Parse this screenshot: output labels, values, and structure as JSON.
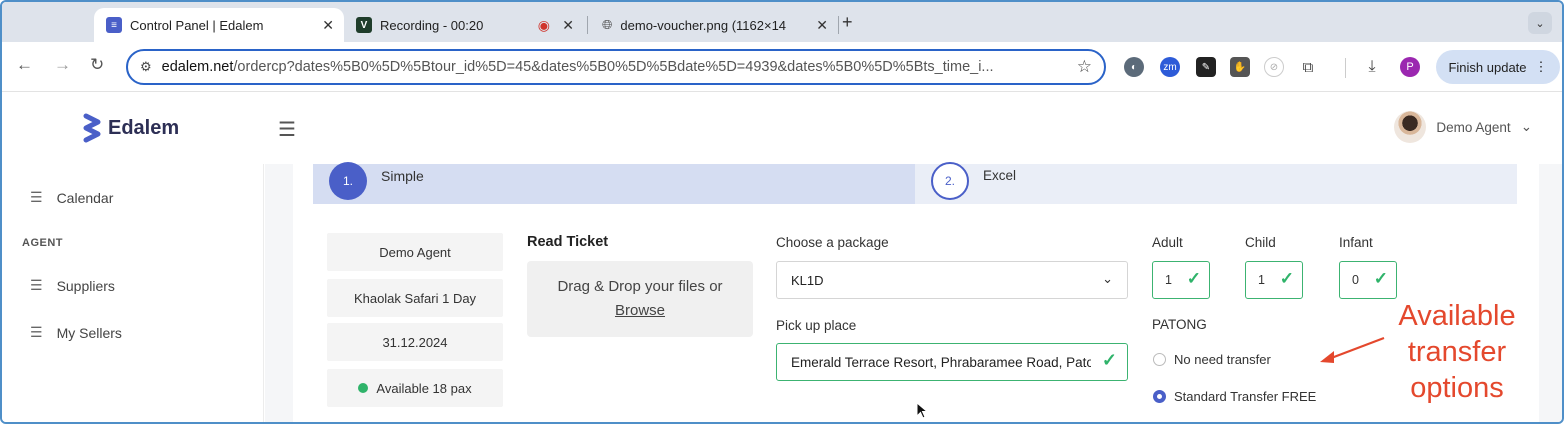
{
  "browser": {
    "tabs": [
      {
        "title": "Control Panel | Edalem",
        "favicon_color": "#4a5fc8",
        "active": true
      },
      {
        "title": "Recording - 00:20",
        "favicon_color": "#1f3d2b",
        "active": false
      },
      {
        "title": "demo-voucher.png (1162×14",
        "favicon": "globe-icon",
        "active": false
      }
    ],
    "new_tab": "+",
    "tab_menu": "⌄",
    "url_host": "edalem.net",
    "url_path": "/ordercp?dates%5B0%5D%5Btour_id%5D=45&dates%5B0%5D%5Bdate%5D=4939&dates%5B0%5D%5Bts_time_i...",
    "finish_update": "Finish update",
    "profile_initial": "P"
  },
  "app": {
    "brand": "Edalem",
    "user_name": "Demo Agent",
    "user_caret": "⌄",
    "accent": "#4a5fc8",
    "success": "#2fb36a"
  },
  "sidebar": {
    "items_top": [
      {
        "label": "Calendar"
      }
    ],
    "section_heading": "AGENT",
    "items": [
      {
        "label": "Suppliers"
      },
      {
        "label": "My Sellers"
      }
    ]
  },
  "steps": [
    {
      "number": "1.",
      "label": "Simple",
      "active": true
    },
    {
      "number": "2.",
      "label": "Excel",
      "active": false
    }
  ],
  "summary": {
    "agent": "Demo Agent",
    "tour": "Khaolak Safari 1 Day",
    "date": "31.12.2024",
    "availability": "Available 18 pax"
  },
  "ticket": {
    "heading": "Read Ticket",
    "drop_text": "Drag & Drop your files or",
    "browse": "Browse"
  },
  "package": {
    "label": "Choose a package",
    "selected": "KL1D"
  },
  "pickup": {
    "label": "Pick up place",
    "value": "Emerald Terrace Resort, Phrabaramee Road, Patong"
  },
  "pax": {
    "adult_label": "Adult",
    "adult": "1",
    "child_label": "Child",
    "child": "1",
    "infant_label": "Infant",
    "infant": "0"
  },
  "transfer": {
    "area": "PATONG",
    "options": [
      {
        "label": "No need transfer",
        "selected": false
      },
      {
        "label": "Standard Transfer FREE",
        "selected": true
      }
    ]
  },
  "annotation": {
    "lines": [
      "Available",
      "transfer",
      "options"
    ],
    "color": "#e4482d"
  }
}
